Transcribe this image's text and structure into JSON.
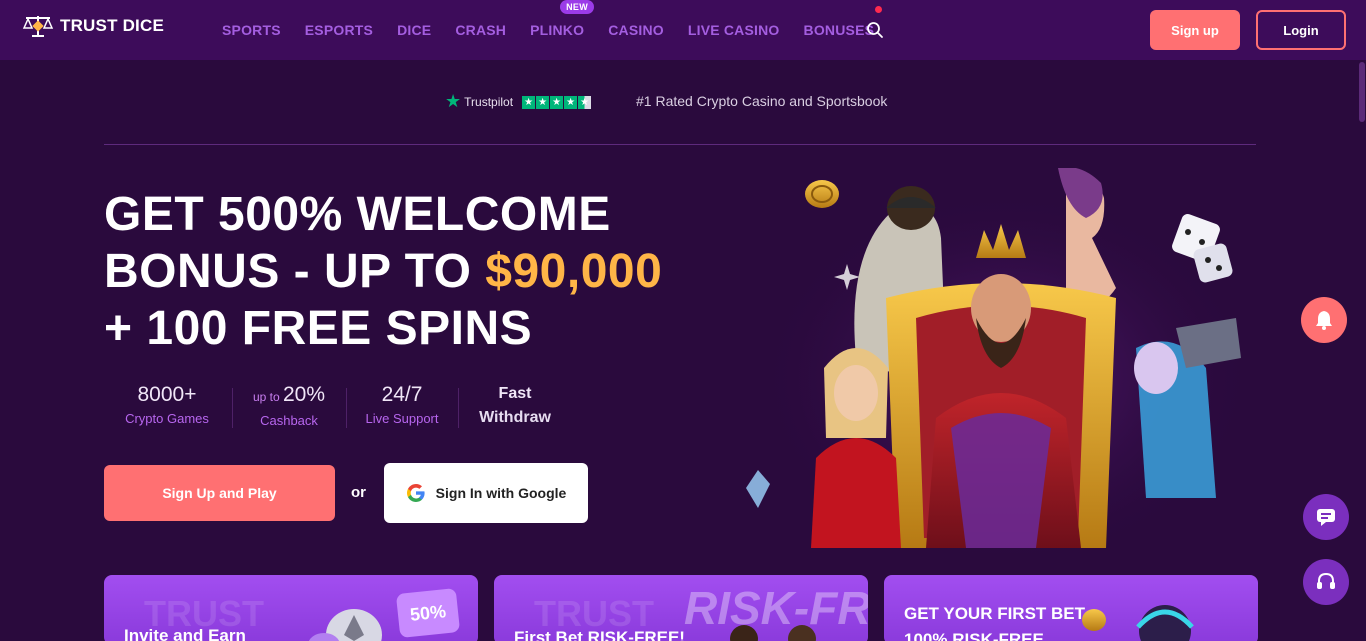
{
  "header": {
    "logo_text": "TRUST DICE",
    "nav": [
      {
        "label": "SPORTS"
      },
      {
        "label": "ESPORTS"
      },
      {
        "label": "DICE"
      },
      {
        "label": "CRASH"
      },
      {
        "label": "PLINKO",
        "badge": "NEW"
      },
      {
        "label": "CASINO"
      },
      {
        "label": "LIVE CASINO"
      },
      {
        "label": "BONUSES",
        "dot": true
      }
    ],
    "signup_label": "Sign up",
    "login_label": "Login"
  },
  "trust": {
    "brand": "Trustpilot",
    "text": "#1 Rated Crypto Casino and Sportsbook"
  },
  "hero": {
    "title_line1": "GET 500% WELCOME",
    "title_line2_pre": "BONUS - UP TO ",
    "title_amount": "$90,000",
    "title_line3": "+ 100 FREE SPINS",
    "stats": [
      {
        "prefix": "",
        "value": "8000+",
        "label": "Crypto Games"
      },
      {
        "prefix": "up to ",
        "value": "20%",
        "label": "Cashback"
      },
      {
        "prefix": "",
        "value": "24/7",
        "label": "Live Support"
      },
      {
        "prefix": "",
        "value": "Fast",
        "label": "Withdraw"
      }
    ],
    "play_label": "Sign Up and Play",
    "or_label": "or",
    "google_label": "Sign In with Google"
  },
  "cards": [
    {
      "title": "Invite and Earn",
      "watermark": "TRUST",
      "badge": "50%"
    },
    {
      "title": "First Bet RISK-FREE!",
      "watermark": "RISK-FREE"
    },
    {
      "title": "GET YOUR FIRST BET",
      "subtitle": "100% RISK-FREE"
    }
  ],
  "colors": {
    "header_bg": "#3d0c5a",
    "page_bg": "#2a0a3d",
    "accent": "#ff7072",
    "nav_text": "#a45ee0",
    "amount": "#ffb547",
    "trustpilot_green": "#00b67a"
  }
}
